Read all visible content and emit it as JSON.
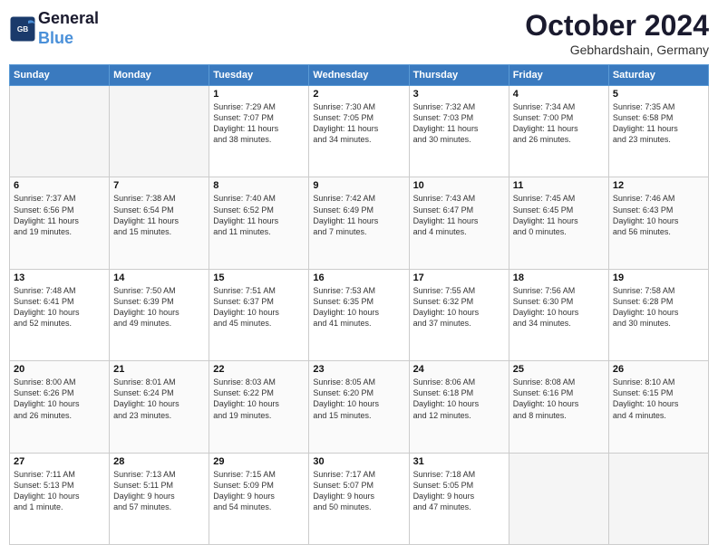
{
  "header": {
    "logo_line1": "General",
    "logo_line2": "Blue",
    "month": "October 2024",
    "location": "Gebhardshain, Germany"
  },
  "days_of_week": [
    "Sunday",
    "Monday",
    "Tuesday",
    "Wednesday",
    "Thursday",
    "Friday",
    "Saturday"
  ],
  "weeks": [
    [
      {
        "day": "",
        "info": ""
      },
      {
        "day": "",
        "info": ""
      },
      {
        "day": "1",
        "info": "Sunrise: 7:29 AM\nSunset: 7:07 PM\nDaylight: 11 hours\nand 38 minutes."
      },
      {
        "day": "2",
        "info": "Sunrise: 7:30 AM\nSunset: 7:05 PM\nDaylight: 11 hours\nand 34 minutes."
      },
      {
        "day": "3",
        "info": "Sunrise: 7:32 AM\nSunset: 7:03 PM\nDaylight: 11 hours\nand 30 minutes."
      },
      {
        "day": "4",
        "info": "Sunrise: 7:34 AM\nSunset: 7:00 PM\nDaylight: 11 hours\nand 26 minutes."
      },
      {
        "day": "5",
        "info": "Sunrise: 7:35 AM\nSunset: 6:58 PM\nDaylight: 11 hours\nand 23 minutes."
      }
    ],
    [
      {
        "day": "6",
        "info": "Sunrise: 7:37 AM\nSunset: 6:56 PM\nDaylight: 11 hours\nand 19 minutes."
      },
      {
        "day": "7",
        "info": "Sunrise: 7:38 AM\nSunset: 6:54 PM\nDaylight: 11 hours\nand 15 minutes."
      },
      {
        "day": "8",
        "info": "Sunrise: 7:40 AM\nSunset: 6:52 PM\nDaylight: 11 hours\nand 11 minutes."
      },
      {
        "day": "9",
        "info": "Sunrise: 7:42 AM\nSunset: 6:49 PM\nDaylight: 11 hours\nand 7 minutes."
      },
      {
        "day": "10",
        "info": "Sunrise: 7:43 AM\nSunset: 6:47 PM\nDaylight: 11 hours\nand 4 minutes."
      },
      {
        "day": "11",
        "info": "Sunrise: 7:45 AM\nSunset: 6:45 PM\nDaylight: 11 hours\nand 0 minutes."
      },
      {
        "day": "12",
        "info": "Sunrise: 7:46 AM\nSunset: 6:43 PM\nDaylight: 10 hours\nand 56 minutes."
      }
    ],
    [
      {
        "day": "13",
        "info": "Sunrise: 7:48 AM\nSunset: 6:41 PM\nDaylight: 10 hours\nand 52 minutes."
      },
      {
        "day": "14",
        "info": "Sunrise: 7:50 AM\nSunset: 6:39 PM\nDaylight: 10 hours\nand 49 minutes."
      },
      {
        "day": "15",
        "info": "Sunrise: 7:51 AM\nSunset: 6:37 PM\nDaylight: 10 hours\nand 45 minutes."
      },
      {
        "day": "16",
        "info": "Sunrise: 7:53 AM\nSunset: 6:35 PM\nDaylight: 10 hours\nand 41 minutes."
      },
      {
        "day": "17",
        "info": "Sunrise: 7:55 AM\nSunset: 6:32 PM\nDaylight: 10 hours\nand 37 minutes."
      },
      {
        "day": "18",
        "info": "Sunrise: 7:56 AM\nSunset: 6:30 PM\nDaylight: 10 hours\nand 34 minutes."
      },
      {
        "day": "19",
        "info": "Sunrise: 7:58 AM\nSunset: 6:28 PM\nDaylight: 10 hours\nand 30 minutes."
      }
    ],
    [
      {
        "day": "20",
        "info": "Sunrise: 8:00 AM\nSunset: 6:26 PM\nDaylight: 10 hours\nand 26 minutes."
      },
      {
        "day": "21",
        "info": "Sunrise: 8:01 AM\nSunset: 6:24 PM\nDaylight: 10 hours\nand 23 minutes."
      },
      {
        "day": "22",
        "info": "Sunrise: 8:03 AM\nSunset: 6:22 PM\nDaylight: 10 hours\nand 19 minutes."
      },
      {
        "day": "23",
        "info": "Sunrise: 8:05 AM\nSunset: 6:20 PM\nDaylight: 10 hours\nand 15 minutes."
      },
      {
        "day": "24",
        "info": "Sunrise: 8:06 AM\nSunset: 6:18 PM\nDaylight: 10 hours\nand 12 minutes."
      },
      {
        "day": "25",
        "info": "Sunrise: 8:08 AM\nSunset: 6:16 PM\nDaylight: 10 hours\nand 8 minutes."
      },
      {
        "day": "26",
        "info": "Sunrise: 8:10 AM\nSunset: 6:15 PM\nDaylight: 10 hours\nand 4 minutes."
      }
    ],
    [
      {
        "day": "27",
        "info": "Sunrise: 7:11 AM\nSunset: 5:13 PM\nDaylight: 10 hours\nand 1 minute."
      },
      {
        "day": "28",
        "info": "Sunrise: 7:13 AM\nSunset: 5:11 PM\nDaylight: 9 hours\nand 57 minutes."
      },
      {
        "day": "29",
        "info": "Sunrise: 7:15 AM\nSunset: 5:09 PM\nDaylight: 9 hours\nand 54 minutes."
      },
      {
        "day": "30",
        "info": "Sunrise: 7:17 AM\nSunset: 5:07 PM\nDaylight: 9 hours\nand 50 minutes."
      },
      {
        "day": "31",
        "info": "Sunrise: 7:18 AM\nSunset: 5:05 PM\nDaylight: 9 hours\nand 47 minutes."
      },
      {
        "day": "",
        "info": ""
      },
      {
        "day": "",
        "info": ""
      }
    ]
  ]
}
